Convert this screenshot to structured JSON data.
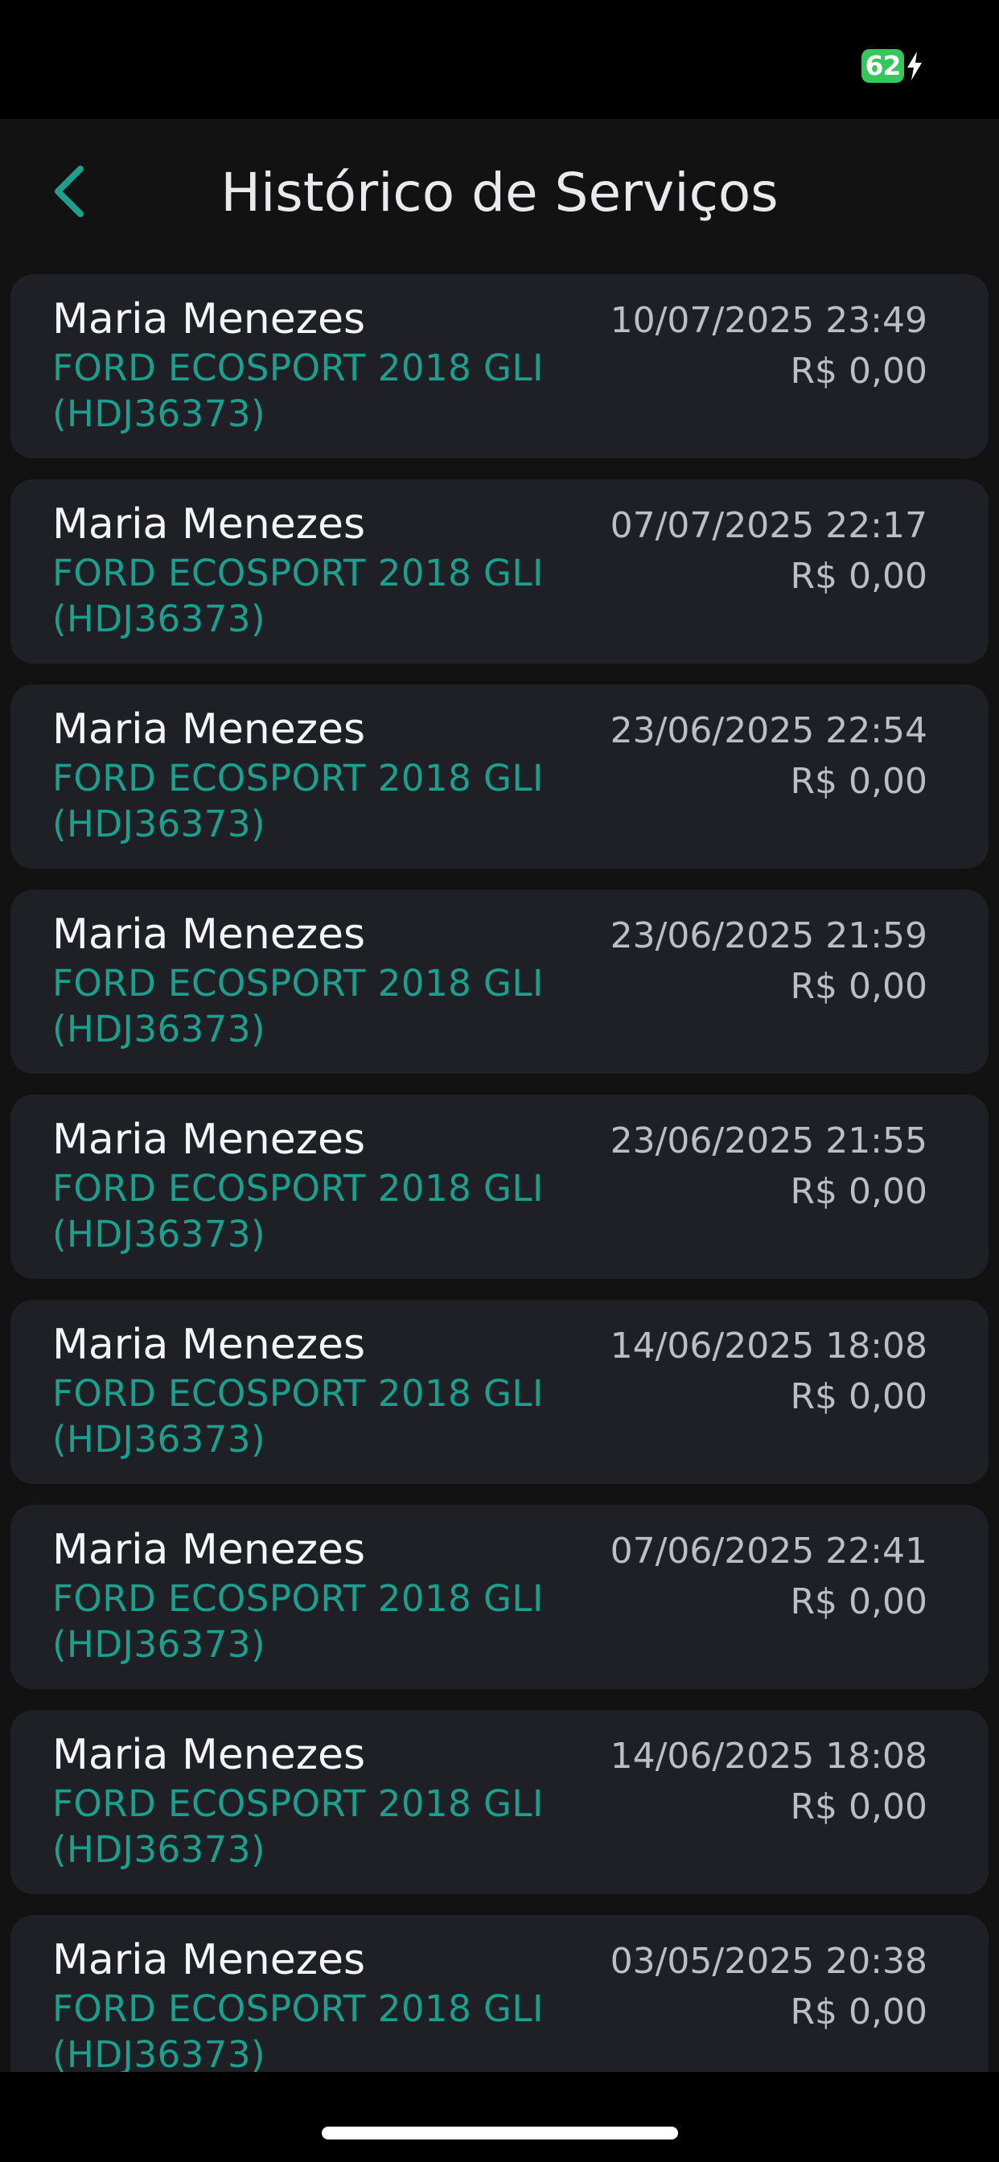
{
  "status_bar": {
    "battery_level": "62"
  },
  "header": {
    "title": "Histórico de Serviços",
    "back_icon": "chevron-left-icon"
  },
  "colors": {
    "accent": "#1ba08f",
    "battery": "#34c759",
    "card_background": "#1f1f26",
    "screen_background": "#121212"
  },
  "services": [
    {
      "client": "Maria Menezes",
      "vehicle": "FORD ECOSPORT 2018 GLI (HDJ36373)",
      "date": "10/07/2025 23:49",
      "price": "R$ 0,00"
    },
    {
      "client": "Maria Menezes",
      "vehicle": "FORD ECOSPORT 2018 GLI (HDJ36373)",
      "date": "07/07/2025 22:17",
      "price": "R$ 0,00"
    },
    {
      "client": "Maria Menezes",
      "vehicle": "FORD ECOSPORT 2018 GLI (HDJ36373)",
      "date": "23/06/2025 22:54",
      "price": "R$ 0,00"
    },
    {
      "client": "Maria Menezes",
      "vehicle": "FORD ECOSPORT 2018 GLI (HDJ36373)",
      "date": "23/06/2025 21:59",
      "price": "R$ 0,00"
    },
    {
      "client": "Maria Menezes",
      "vehicle": "FORD ECOSPORT 2018 GLI (HDJ36373)",
      "date": "23/06/2025 21:55",
      "price": "R$ 0,00"
    },
    {
      "client": "Maria Menezes",
      "vehicle": "FORD ECOSPORT 2018 GLI (HDJ36373)",
      "date": "14/06/2025 18:08",
      "price": "R$ 0,00"
    },
    {
      "client": "Maria Menezes",
      "vehicle": "FORD ECOSPORT 2018 GLI (HDJ36373)",
      "date": "07/06/2025 22:41",
      "price": "R$ 0,00"
    },
    {
      "client": "Maria Menezes",
      "vehicle": "FORD ECOSPORT 2018 GLI (HDJ36373)",
      "date": "14/06/2025 18:08",
      "price": "R$ 0,00"
    },
    {
      "client": "Maria Menezes",
      "vehicle": "FORD ECOSPORT 2018 GLI (HDJ36373)",
      "date": "03/05/2025 20:38",
      "price": "R$ 0,00"
    }
  ]
}
